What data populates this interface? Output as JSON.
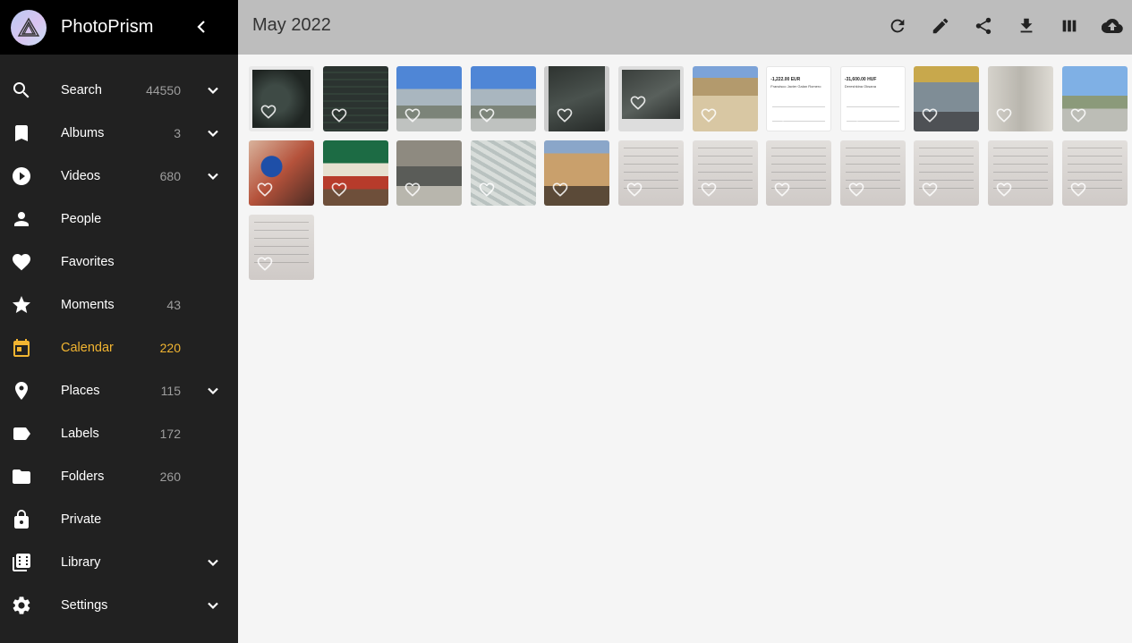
{
  "app": {
    "name": "PhotoPrism"
  },
  "sidebar": {
    "items": [
      {
        "id": "search",
        "label": "Search",
        "count": "44550",
        "icon": "search-icon",
        "expandable": true
      },
      {
        "id": "albums",
        "label": "Albums",
        "count": "3",
        "icon": "bookmark-icon",
        "expandable": true
      },
      {
        "id": "videos",
        "label": "Videos",
        "count": "680",
        "icon": "play-circle-icon",
        "expandable": true
      },
      {
        "id": "people",
        "label": "People",
        "count": "",
        "icon": "person-icon",
        "expandable": false
      },
      {
        "id": "favorites",
        "label": "Favorites",
        "count": "",
        "icon": "heart-icon",
        "expandable": false
      },
      {
        "id": "moments",
        "label": "Moments",
        "count": "43",
        "icon": "star-icon",
        "expandable": false
      },
      {
        "id": "calendar",
        "label": "Calendar",
        "count": "220",
        "icon": "calendar-icon",
        "expandable": false,
        "active": true
      },
      {
        "id": "places",
        "label": "Places",
        "count": "115",
        "icon": "place-icon",
        "expandable": true
      },
      {
        "id": "labels",
        "label": "Labels",
        "count": "172",
        "icon": "label-icon",
        "expandable": false
      },
      {
        "id": "folders",
        "label": "Folders",
        "count": "260",
        "icon": "folder-icon",
        "expandable": false
      },
      {
        "id": "private",
        "label": "Private",
        "count": "",
        "icon": "lock-icon",
        "expandable": false
      },
      {
        "id": "library",
        "label": "Library",
        "count": "",
        "icon": "library-icon",
        "expandable": true
      },
      {
        "id": "settings",
        "label": "Settings",
        "count": "",
        "icon": "gear-icon",
        "expandable": true
      }
    ]
  },
  "toolbar": {
    "title": "May 2022",
    "actions": [
      "refresh-icon",
      "edit-icon",
      "share-icon",
      "download-icon",
      "view-columns-icon",
      "upload-icon"
    ]
  },
  "colors": {
    "sidebar_bg": "#212121",
    "brand_bg": "#000000",
    "toolbar_bg": "#bdbdbd",
    "active": "#f2b531",
    "content_bg": "#f5f5f5"
  },
  "photos": [
    {
      "style": "slate"
    },
    {
      "style": "board"
    },
    {
      "style": "sky"
    },
    {
      "style": "sky"
    },
    {
      "style": "glass"
    },
    {
      "style": "glass2"
    },
    {
      "style": "dome"
    },
    {
      "style": "doc",
      "amount": "-1,222.00 EUR",
      "name": "Francisco Javier Galan Romero"
    },
    {
      "style": "doc",
      "amount": "-31,600.00 HUF",
      "name": "Dereshkina Oksana"
    },
    {
      "style": "bldg"
    },
    {
      "style": "wall"
    },
    {
      "style": "statue"
    },
    {
      "style": "keys"
    },
    {
      "style": "shop"
    },
    {
      "style": "street"
    },
    {
      "style": "map"
    },
    {
      "style": "old"
    },
    {
      "style": "paper"
    },
    {
      "style": "paper"
    },
    {
      "style": "paper"
    },
    {
      "style": "paper"
    },
    {
      "style": "paper"
    },
    {
      "style": "paper"
    },
    {
      "style": "paper"
    },
    {
      "style": "paper"
    }
  ]
}
